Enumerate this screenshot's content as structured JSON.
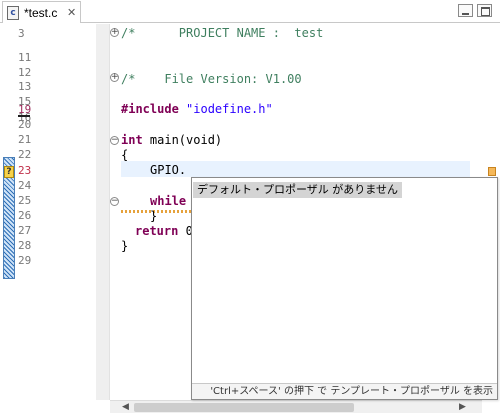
{
  "tab": {
    "icon": "c-source-file-icon",
    "icon_glyph": "c",
    "title": "*test.c",
    "close": "✕"
  },
  "line_numbers": [
    "3",
    "11",
    "12",
    "13",
    "15",
    "16",
    "19",
    "20",
    "21",
    "22",
    "23",
    "24",
    "25",
    "26",
    "27",
    "28",
    "29"
  ],
  "code": {
    "project_comment_prefix": "/*",
    "project_comment_body": "      PROJECT NAME :  test",
    "version_comment_prefix": "/*",
    "version_comment_body": "    File Version: V1.00",
    "include_kw": "#include",
    "include_str": " \"iodefine.h\"",
    "main_kw": "int",
    "main_rest": " main(void)",
    "brace_open": "{",
    "gpio_line": "GPIO.",
    "while_kw": "while",
    "while_rest": " ",
    "brace_inner_close": "}",
    "return_kw": "return",
    "return_rest": " 0",
    "brace_close": "}"
  },
  "fold_markers": {
    "expand": "+",
    "collapse": "−"
  },
  "ruler_mark": "?",
  "scrollbar": {
    "left_arrow": "◀",
    "right_arrow": "▶"
  },
  "popup": {
    "message": "デフォルト・プロポーザル がありません",
    "status": "'Ctrl+スペース' の押下 で テンプレート・プロポーザル を表示"
  },
  "colors": {
    "keyword": "#7f0055",
    "comment": "#3f7f5f",
    "string": "#2a00ff",
    "current_line": "#e8f2fe"
  }
}
